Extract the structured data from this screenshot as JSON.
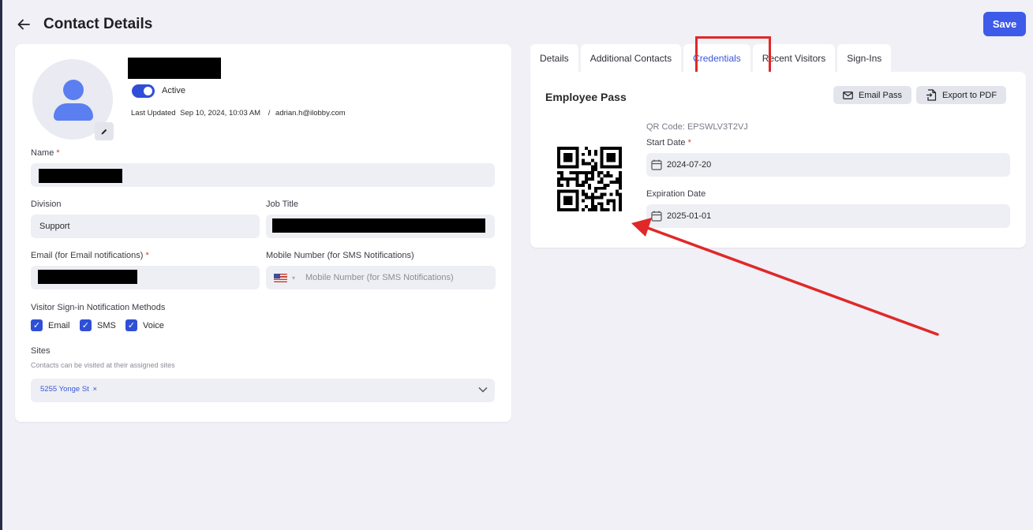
{
  "header": {
    "title": "Contact Details",
    "save_label": "Save"
  },
  "profile": {
    "status_label": "Active",
    "last_updated_label": "Last Updated",
    "last_updated_value": "Sep 10, 2024, 10:03 AM",
    "separator": "/",
    "updated_by": "adrian.h@ilobby.com"
  },
  "form": {
    "name_label": "Name",
    "division_label": "Division",
    "division_value": "Support",
    "job_title_label": "Job Title",
    "email_label": "Email (for Email notifications)",
    "mobile_label": "Mobile Number (for SMS Notifications)",
    "mobile_placeholder": "Mobile Number (for SMS Notifications)",
    "required_mark": "*",
    "notif_label": "Visitor Sign-in Notification Methods",
    "notif_methods": [
      {
        "label": "Email",
        "checked": true
      },
      {
        "label": "SMS",
        "checked": true
      },
      {
        "label": "Voice",
        "checked": true
      }
    ],
    "sites_label": "Sites",
    "sites_hint": "Contacts can be visited at their assigned sites",
    "site_chip": "5255 Yonge St",
    "site_chip_remove": "×"
  },
  "tabs": [
    {
      "label": "Details",
      "active": false
    },
    {
      "label": "Additional Contacts",
      "active": false
    },
    {
      "label": "Credentials",
      "active": true
    },
    {
      "label": "Recent Visitors",
      "active": false
    },
    {
      "label": "Sign-Ins",
      "active": false
    }
  ],
  "credentials": {
    "title": "Employee Pass",
    "email_pass_label": "Email Pass",
    "export_pdf_label": "Export to PDF",
    "qr_code_text": "QR Code: EPSWLV3T2VJ",
    "start_date_label": "Start Date",
    "start_date_value": "2024-07-20",
    "expiration_label": "Expiration Date",
    "expiration_value": "2025-01-01"
  },
  "colors": {
    "accent": "#3d5ae8",
    "annotation": "#e02828",
    "background": "#f0f0f6"
  }
}
